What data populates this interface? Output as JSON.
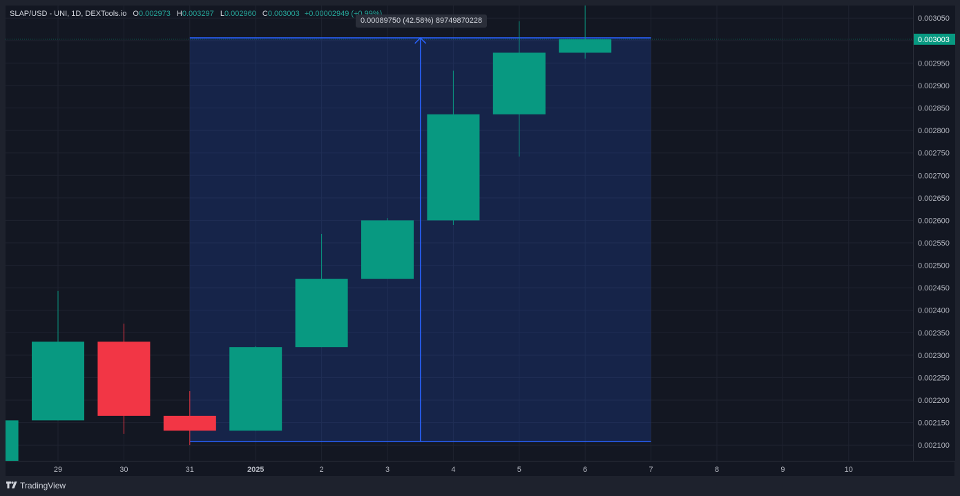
{
  "legend": {
    "symbol": "SLAP/USD - UNI, 1D, DEXTools.io",
    "open_label": "O",
    "open": "0.002973",
    "high_label": "H",
    "high": "0.003297",
    "low_label": "L",
    "low": "0.002960",
    "close_label": "C",
    "close": "0.003003",
    "change": "+0.00002949 (+0.99%)"
  },
  "measure": {
    "label": "0.00089750 (42.58%) 89749870228"
  },
  "current_price": "0.003003",
  "brand": {
    "name": "TradingView",
    "logo": "TV-logo-icon"
  },
  "colors": {
    "up": "#089981",
    "down": "#f23645",
    "measure": "#2962ff",
    "background": "#131722"
  },
  "chart_data": {
    "type": "candlestick",
    "x_labels": [
      "29",
      "30",
      "31",
      "2025",
      "2",
      "3",
      "4",
      "5",
      "6",
      "7",
      "8",
      "9",
      "10"
    ],
    "y_ticks": [
      "0.002100",
      "0.002150",
      "0.002200",
      "0.002250",
      "0.002300",
      "0.002350",
      "0.002400",
      "0.002450",
      "0.002500",
      "0.002550",
      "0.002600",
      "0.002650",
      "0.002700",
      "0.002750",
      "0.002800",
      "0.002850",
      "0.002900",
      "0.002950",
      "0.003000",
      "0.003050"
    ],
    "ylim": [
      0.002065,
      0.003078
    ],
    "candles": [
      {
        "date": "28",
        "open": 0.002058,
        "high": 0.002155,
        "low": 0.002058,
        "close": 0.002155
      },
      {
        "date": "29",
        "open": 0.002155,
        "high": 0.002443,
        "low": 0.002155,
        "close": 0.00233
      },
      {
        "date": "30",
        "open": 0.00233,
        "high": 0.00237,
        "low": 0.002125,
        "close": 0.002165
      },
      {
        "date": "31",
        "open": 0.002165,
        "high": 0.00222,
        "low": 0.0021,
        "close": 0.002132
      },
      {
        "date": "2025-01-01",
        "open": 0.002132,
        "high": 0.00232,
        "low": 0.002132,
        "close": 0.002318
      },
      {
        "date": "2",
        "open": 0.002318,
        "high": 0.00257,
        "low": 0.002318,
        "close": 0.00247
      },
      {
        "date": "3",
        "open": 0.00247,
        "high": 0.002605,
        "low": 0.00247,
        "close": 0.0026
      },
      {
        "date": "4",
        "open": 0.0026,
        "high": 0.002933,
        "low": 0.00259,
        "close": 0.002836
      },
      {
        "date": "5",
        "open": 0.002836,
        "high": 0.003043,
        "low": 0.002742,
        "close": 0.002973
      },
      {
        "date": "6",
        "open": 0.002973,
        "high": 0.003297,
        "low": 0.00296,
        "close": 0.003003
      }
    ],
    "measure_range": {
      "from": 0.002108,
      "to": 0.003006,
      "start": "31",
      "end": "7"
    }
  }
}
